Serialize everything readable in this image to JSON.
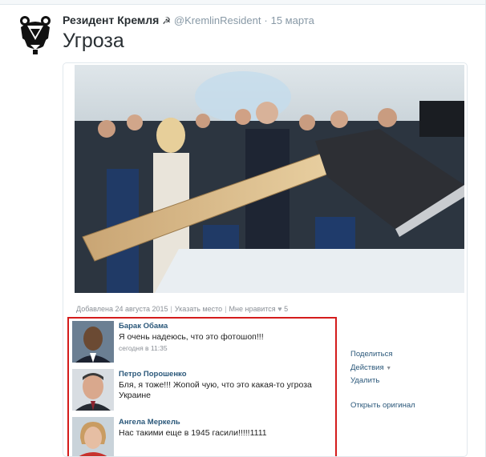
{
  "tweet": {
    "author_name": "Резидент Кремля",
    "author_symbol": "☭",
    "handle": "@KremlinResident",
    "separator": "·",
    "time": "15 марта",
    "text": "Угроза"
  },
  "vk": {
    "added": "Добавлена 24 августа 2015",
    "place": "Указать место",
    "like": "Мне нравится",
    "like_count": "5",
    "comments": [
      {
        "author": "Барак Обама",
        "text": "Я очень надеюсь, что это фотошоп!!!",
        "date": "сегодня в 11:35"
      },
      {
        "author": "Петро Порошенко",
        "text": "Бля, я тоже!!! Жопой чую, что это какая-то угроза Украине",
        "date": ""
      },
      {
        "author": "Ангела Меркель",
        "text": "Нас такими еще в 1945 гасили!!!!!1111",
        "date": ""
      }
    ],
    "actions": {
      "share": "Поделиться",
      "more": "Действия",
      "delete": "Удалить",
      "open_original": "Открыть оригинал"
    }
  },
  "colors": {
    "vk_link": "#2b587a",
    "highlight_border": "#d41c1c",
    "muted": "#8899a6"
  },
  "icons": {
    "avatar": "bear-logo-icon",
    "like": "heart-icon",
    "dropdown": "caret-down-icon"
  }
}
